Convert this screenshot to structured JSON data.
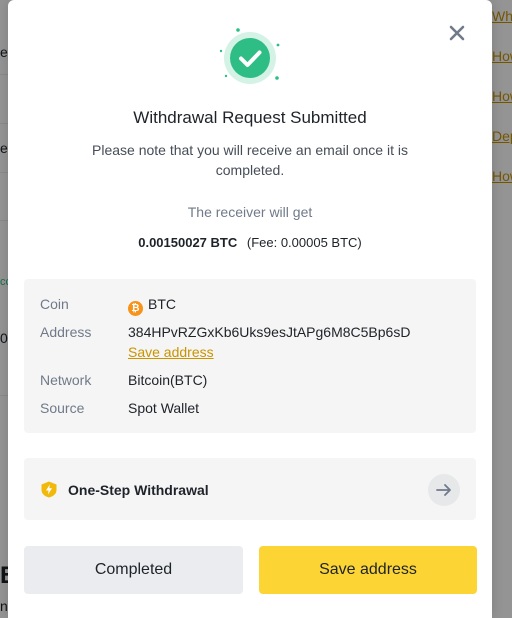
{
  "background": {
    "left_fragments": [
      "er",
      "es",
      "cc",
      "00",
      "B",
      "n"
    ],
    "right_links": [
      "Why",
      "How",
      "How",
      "Dep",
      "How"
    ]
  },
  "modal": {
    "icons": {
      "close": "close-icon",
      "success": "check-circle-icon",
      "coin": "bitcoin-icon",
      "one_step": "shield-lightning-icon",
      "arrow": "arrow-right-icon"
    },
    "title": "Withdrawal Request Submitted",
    "subtitle": "Please note that you will receive an email once it is completed.",
    "receiver_label": "The receiver will get",
    "amount": "0.00150027 BTC",
    "fee": "(Fee: 0.00005 BTC)",
    "details": {
      "coin_label": "Coin",
      "coin_symbol": "₿",
      "coin_value": "BTC",
      "address_label": "Address",
      "address_value": "384HPvRZGxKb6Uks9esJtAPg6M8C5Bp6sD",
      "save_address_link": "Save address",
      "network_label": "Network",
      "network_value": "Bitcoin(BTC)",
      "source_label": "Source",
      "source_value": "Spot Wallet"
    },
    "one_step_label": "One-Step Withdrawal",
    "buttons": {
      "completed": "Completed",
      "save_address": "Save address"
    },
    "colors": {
      "brand_yellow": "#FCD535",
      "link_gold": "#C99400",
      "success_green": "#2EBD85"
    }
  }
}
